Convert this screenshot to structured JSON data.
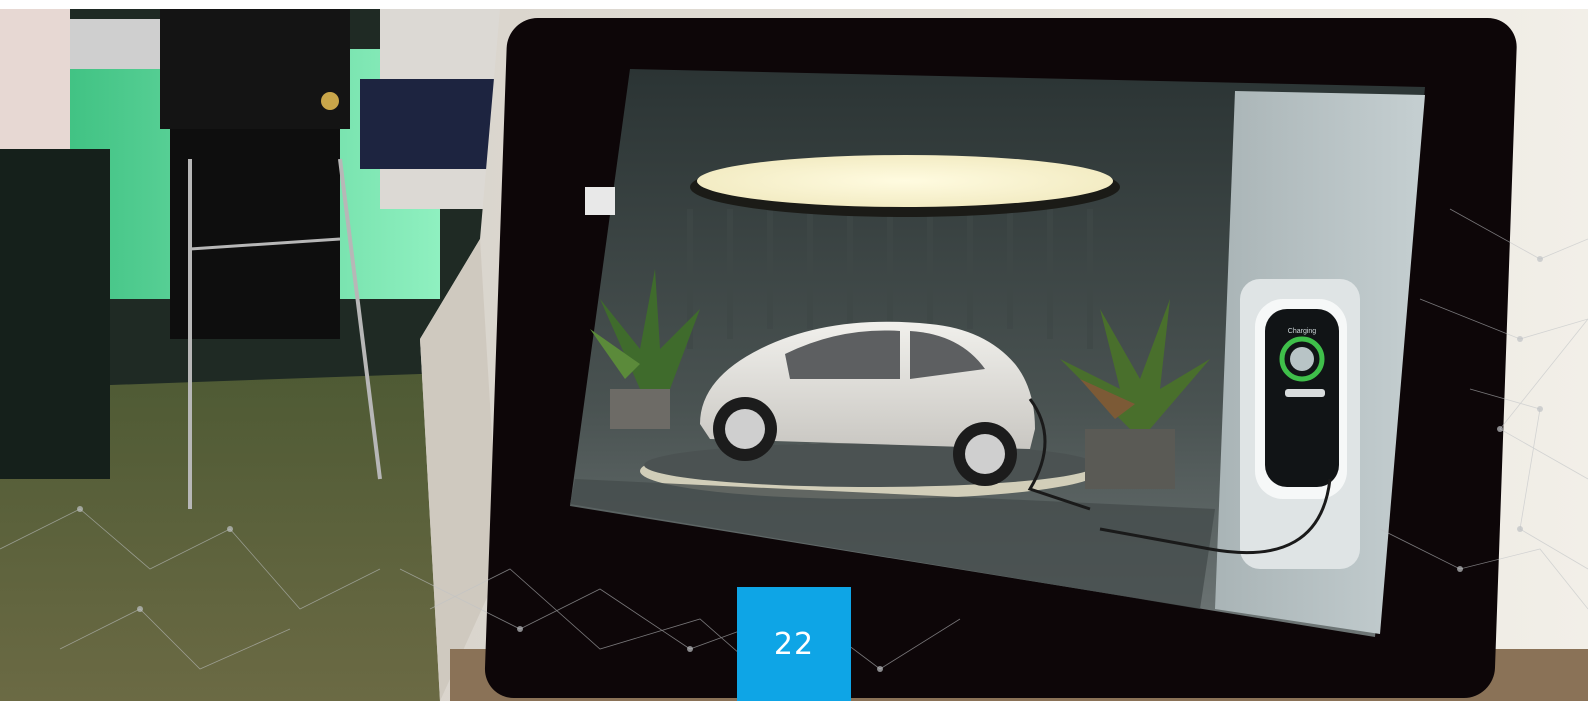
{
  "page_badge": {
    "number": "22",
    "color": "#0ea5e6"
  },
  "scene": {
    "subject": "kiosk-touchscreen-ev-charging",
    "screen_content_icons": [
      "car-icon",
      "charging-station-icon",
      "plant-icon",
      "ceiling-lamp-icon"
    ],
    "station_screen_label": "Charging"
  }
}
